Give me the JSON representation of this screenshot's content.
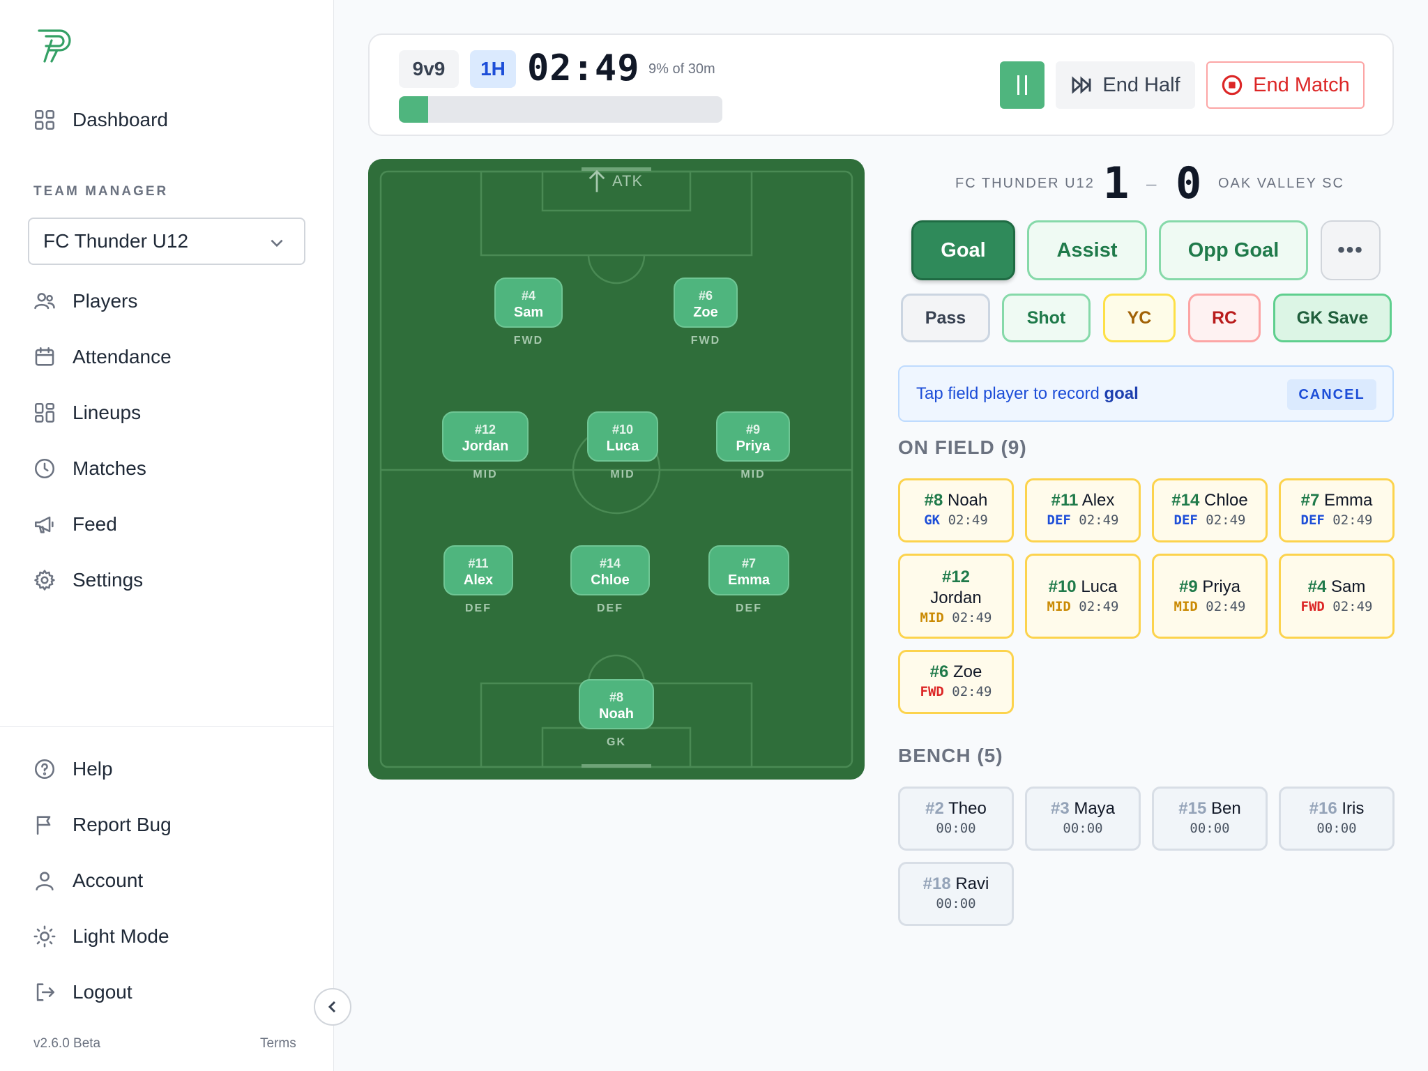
{
  "sidebar": {
    "nav_top": [
      {
        "label": "Dashboard"
      }
    ],
    "section_label": "TEAM MANAGER",
    "team_select": "FC Thunder U12",
    "nav_team": [
      {
        "label": "Players"
      },
      {
        "label": "Attendance"
      },
      {
        "label": "Lineups"
      },
      {
        "label": "Matches"
      },
      {
        "label": "Feed"
      },
      {
        "label": "Settings"
      }
    ],
    "nav_bottom": [
      {
        "label": "Help"
      },
      {
        "label": "Report Bug"
      },
      {
        "label": "Account"
      },
      {
        "label": "Light Mode"
      },
      {
        "label": "Logout"
      }
    ],
    "version": "v2.6.0 Beta",
    "terms": "Terms"
  },
  "topbar": {
    "format": "9v9",
    "half": "1H",
    "clock": "02:49",
    "progress_label": "9% of 30m",
    "progress_fraction": 0.09,
    "end_half_label": "End Half",
    "end_match_label": "End Match"
  },
  "pitch": {
    "attack_label": "ATK",
    "players": [
      {
        "num": "#4",
        "name": "Sam",
        "pos": "FWD"
      },
      {
        "num": "#6",
        "name": "Zoe",
        "pos": "FWD"
      },
      {
        "num": "#12",
        "name": "Jordan",
        "pos": "MID"
      },
      {
        "num": "#10",
        "name": "Luca",
        "pos": "MID"
      },
      {
        "num": "#9",
        "name": "Priya",
        "pos": "MID"
      },
      {
        "num": "#11",
        "name": "Alex",
        "pos": "DEF"
      },
      {
        "num": "#14",
        "name": "Chloe",
        "pos": "DEF"
      },
      {
        "num": "#7",
        "name": "Emma",
        "pos": "DEF"
      },
      {
        "num": "#8",
        "name": "Noah",
        "pos": "GK"
      }
    ]
  },
  "score": {
    "home_team": "FC THUNDER U12",
    "home_score": "1",
    "separator": "–",
    "away_score": "0",
    "away_team": "OAK VALLEY SC"
  },
  "events": {
    "goal": "Goal",
    "assist": "Assist",
    "opp_goal": "Opp Goal",
    "more": "•••",
    "pass": "Pass",
    "shot": "Shot",
    "yc": "YC",
    "rc": "RC",
    "gk_save": "GK Save"
  },
  "hint": {
    "prefix": "Tap field player to record ",
    "action": "goal",
    "cancel": "CANCEL"
  },
  "on_field": {
    "heading": "ON FIELD (9)",
    "players": [
      {
        "num": "#8",
        "name": "Noah",
        "pos": "GK",
        "time": "02:49"
      },
      {
        "num": "#11",
        "name": "Alex",
        "pos": "DEF",
        "time": "02:49"
      },
      {
        "num": "#14",
        "name": "Chloe",
        "pos": "DEF",
        "time": "02:49"
      },
      {
        "num": "#7",
        "name": "Emma",
        "pos": "DEF",
        "time": "02:49"
      },
      {
        "num": "#12",
        "name": "Jordan",
        "pos": "MID",
        "time": "02:49"
      },
      {
        "num": "#10",
        "name": "Luca",
        "pos": "MID",
        "time": "02:49"
      },
      {
        "num": "#9",
        "name": "Priya",
        "pos": "MID",
        "time": "02:49"
      },
      {
        "num": "#4",
        "name": "Sam",
        "pos": "FWD",
        "time": "02:49"
      },
      {
        "num": "#6",
        "name": "Zoe",
        "pos": "FWD",
        "time": "02:49"
      }
    ]
  },
  "bench": {
    "heading": "BENCH (5)",
    "players": [
      {
        "num": "#2",
        "name": "Theo",
        "time": "00:00"
      },
      {
        "num": "#3",
        "name": "Maya",
        "time": "00:00"
      },
      {
        "num": "#15",
        "name": "Ben",
        "time": "00:00"
      },
      {
        "num": "#16",
        "name": "Iris",
        "time": "00:00"
      },
      {
        "num": "#18",
        "name": "Ravi",
        "time": "00:00"
      }
    ]
  }
}
